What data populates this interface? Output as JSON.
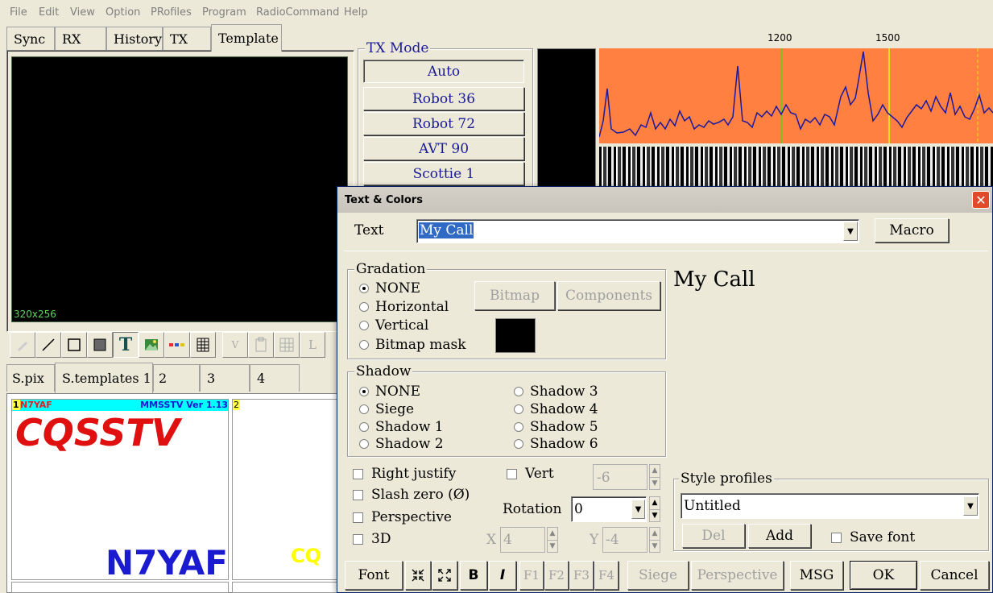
{
  "menu": [
    "File",
    "Edit",
    "View",
    "Option",
    "PRofiles",
    "Program",
    "RadioCommand",
    "Help"
  ],
  "tabs": [
    "Sync",
    "RX",
    "History",
    "TX",
    "Template"
  ],
  "canvas_size": "320x256",
  "tx_mode": {
    "title": "TX Mode",
    "modes": [
      "Auto",
      "Robot 36",
      "Robot 72",
      "AVT 90",
      "Scottie 1"
    ]
  },
  "spectrum": {
    "tick_1200": "1200",
    "tick_1500": "1500"
  },
  "tools": {
    "v": "V",
    "l": "L"
  },
  "bottom_tabs": [
    "S.pix",
    "S.templates 1",
    "2",
    "3",
    "4"
  ],
  "thumbs": {
    "t1_num": "1",
    "t1_call": "N7YAF",
    "t1_ver": "MMSSTV Ver 1.13",
    "t1_main": "CQSSTV",
    "t1_bottom": "N7YAF",
    "t2_num": "2",
    "t2_text": "CQ"
  },
  "dialog": {
    "title": "Text & Colors",
    "text_label": "Text",
    "text_value": "My Call",
    "macro": "Macro",
    "gradation": {
      "title": "Gradation",
      "options": [
        "NONE",
        "Horizontal",
        "Vertical",
        "Bitmap mask"
      ],
      "selected": "NONE"
    },
    "bitmap": "Bitmap",
    "components": "Components",
    "preview": "My Call",
    "shadow": {
      "title": "Shadow",
      "options": [
        "NONE",
        "Siege",
        "Shadow 1",
        "Shadow 2",
        "Shadow 3",
        "Shadow 4",
        "Shadow 5",
        "Shadow 6"
      ],
      "selected": "NONE"
    },
    "right_justify": "Right justify",
    "slash_zero": "Slash zero (Ø)",
    "perspective": "Perspective",
    "three_d": "3D",
    "vert": "Vert",
    "vert_value": "-6",
    "rotation_label": "Rotation",
    "rotation_value": "0",
    "x_label": "X",
    "x_value": "4",
    "y_label": "Y",
    "y_value": "-4",
    "style_profiles": {
      "title": "Style profiles",
      "value": "Untitled",
      "del": "Del",
      "add": "Add",
      "save_font": "Save font"
    },
    "buttons": {
      "font": "Font",
      "bold": "B",
      "italic": "I",
      "f1": "F1",
      "f2": "F2",
      "f3": "F3",
      "f4": "F4",
      "siege": "Siege",
      "perspective": "Perspective",
      "msg": "MSG",
      "ok": "OK",
      "cancel": "Cancel"
    }
  },
  "colors": {
    "spectrum_bg": "#ff8040",
    "spectrum_line": "#1a1aa0",
    "accent_cyan": "#00ffff"
  }
}
